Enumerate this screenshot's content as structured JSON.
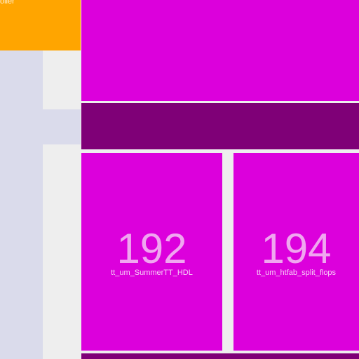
{
  "toolbar": {
    "title_fragment": "oller",
    "color": "#ffa500"
  },
  "sidebar": {
    "color": "#dadbeb"
  },
  "tiles": [
    {
      "id": "top",
      "color": "#dc00dc"
    },
    {
      "id": "band",
      "color": "#7f0077"
    },
    {
      "id": "left",
      "count": "192",
      "label": "tt_um_SummerTT_HDL",
      "color": "#dc00dc"
    },
    {
      "id": "right",
      "count": "194",
      "label": "tt_um_htfab_split_flops",
      "color": "#dc00dc"
    },
    {
      "id": "bottom",
      "color": "#7f0077"
    }
  ]
}
